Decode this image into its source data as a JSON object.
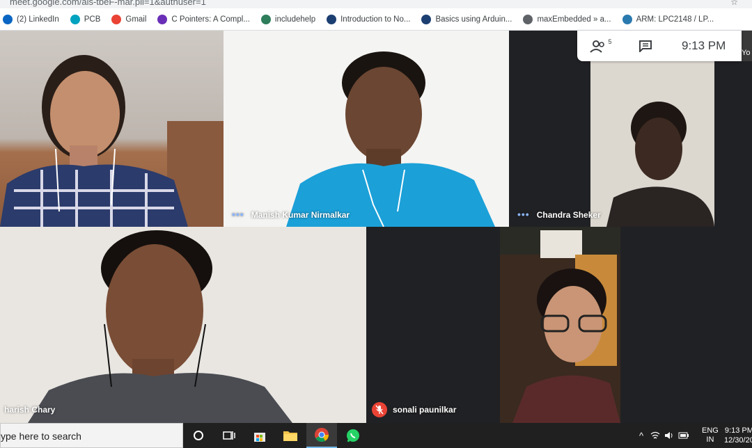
{
  "browser": {
    "url_fragment": "meet.google.com/ais-tbeF-mar.pli=1&authuser=1",
    "bookmarks": [
      {
        "label": "(2) LinkedIn",
        "icon": "linkedin-icon",
        "color": "#0a66c2"
      },
      {
        "label": "PCB",
        "icon": "pcb-icon",
        "color": "#00a3bf"
      },
      {
        "label": "Gmail",
        "icon": "gmail-icon",
        "color": "#ea4335"
      },
      {
        "label": "C Pointers: A Compl...",
        "icon": "p-icon",
        "color": "#6a2fb7"
      },
      {
        "label": "includehelp",
        "icon": "includehelp-icon",
        "color": "#2e7d5b"
      },
      {
        "label": "Introduction to No...",
        "icon": "ew-icon",
        "color": "#1c3f72"
      },
      {
        "label": "Basics using Arduin...",
        "icon": "ew-icon",
        "color": "#1c3f72"
      },
      {
        "label": "maxEmbedded » a...",
        "icon": "globe-icon",
        "color": "#5f6368"
      },
      {
        "label": "ARM: LPC2148 / LP...",
        "icon": "arm-icon",
        "color": "#2a7ab0"
      }
    ]
  },
  "meet": {
    "participant_count": "5",
    "time": "9:13 PM",
    "you_label": "Yo",
    "participants": [
      {
        "name": "Manish Kumar Nirmalkar",
        "speaking": true
      },
      {
        "name": "Chandra Sheker",
        "speaking": true
      },
      {
        "name": "harish Chary",
        "speaking": false
      },
      {
        "name": "sonali paunilkar",
        "muted": true
      }
    ]
  },
  "taskbar": {
    "search_text": "ype here to search",
    "lang_top": "ENG",
    "lang_bottom": "IN",
    "clock_time": "9:13 PM",
    "clock_date": "12/30/20"
  },
  "colors": {
    "meet_dark": "#202124",
    "muted_red": "#ea4335",
    "speaking_blue": "#8ab4f8"
  }
}
